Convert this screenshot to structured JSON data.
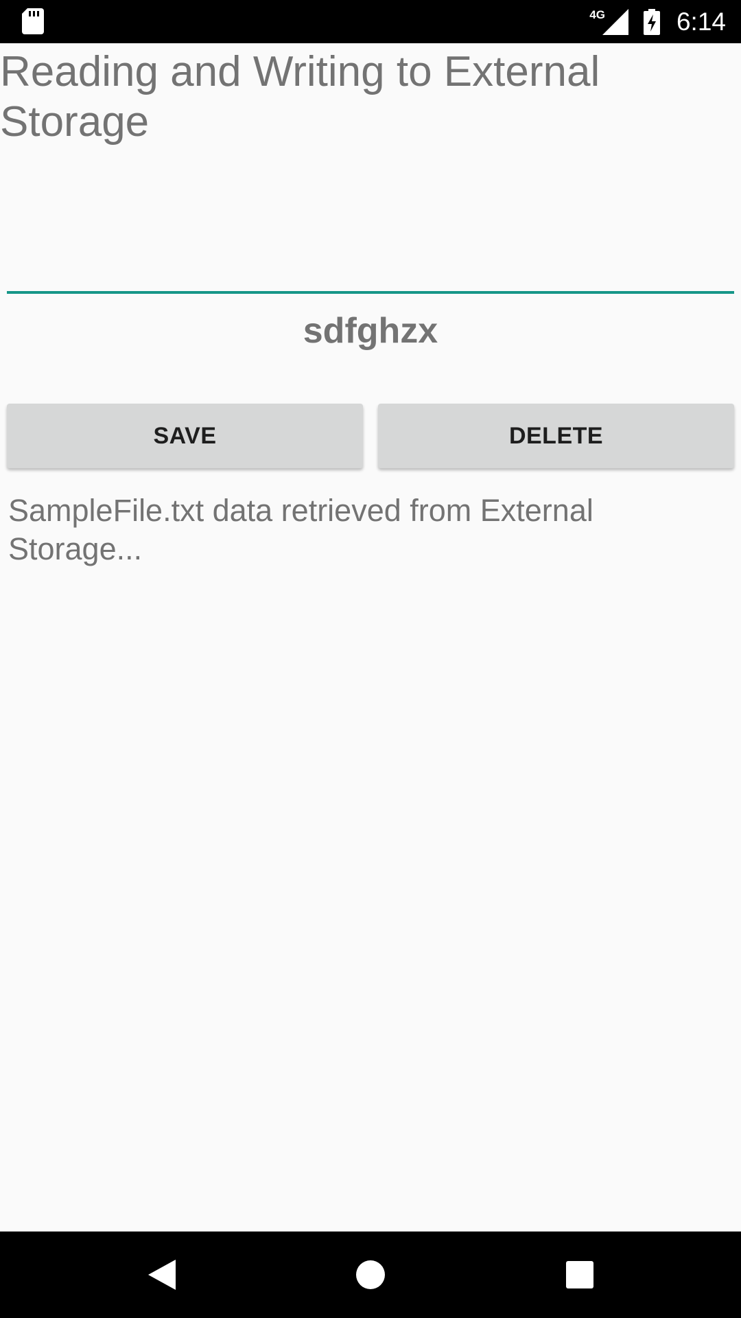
{
  "status_bar": {
    "network": "4G",
    "time": "6:14",
    "icons": [
      "sd-card-icon",
      "signal-icon",
      "battery-charging-icon"
    ]
  },
  "app": {
    "title": "Reading and Writing to External Storage",
    "input": {
      "value": "",
      "placeholder": ""
    },
    "entered_text": "sdfghzx",
    "buttons": {
      "save_label": "SAVE",
      "delete_label": "DELETE"
    },
    "result_text": "SampleFile.txt data retrieved from External Storage..."
  },
  "nav_bar": {
    "icons": [
      "back-icon",
      "home-icon",
      "recents-icon"
    ]
  },
  "colors": {
    "accent": "#159688",
    "background": "#fafafa",
    "button": "#d6d7d7",
    "text_secondary": "#737373"
  }
}
